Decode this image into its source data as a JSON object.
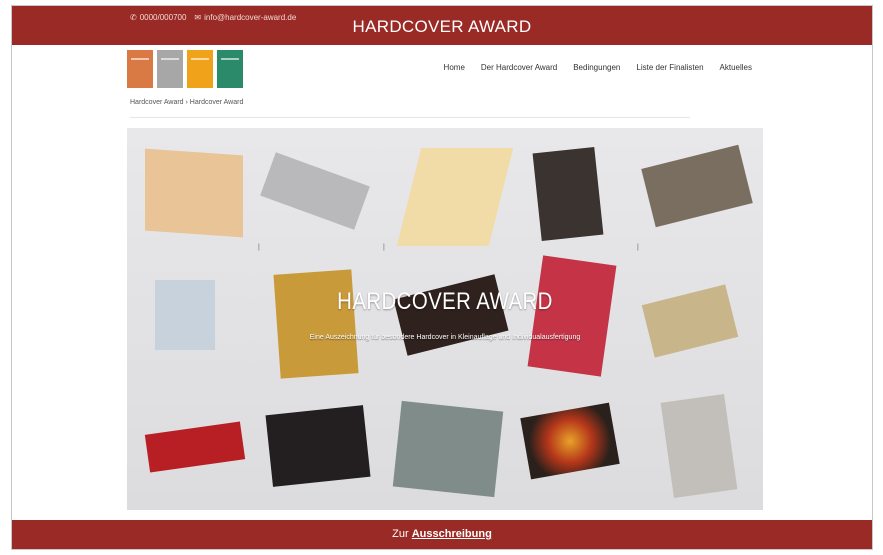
{
  "header": {
    "phone": "0000/000700",
    "email": "info@hardcover-award.de",
    "title": "HARDCOVER AWARD"
  },
  "logo": {
    "colors": [
      "#d97a45",
      "#a7a7a7",
      "#f0a21a",
      "#2a8a6a"
    ]
  },
  "nav": {
    "items": [
      "Home",
      "Der Hardcover Award",
      "Bedingungen",
      "Liste der Finalisten",
      "Aktuelles"
    ]
  },
  "breadcrumb": "Hardcover Award › Hardcover Award",
  "hero": {
    "title": "HARDCOVER AWARD",
    "subtitle": "Eine Auszeichnung für besondere Hardcover in Kleinauflage und Individualausfertigung"
  },
  "footer": {
    "cta_prefix": "Zur",
    "cta_link": "Ausschreibung"
  },
  "colors": {
    "brand": "#9a2a25"
  }
}
